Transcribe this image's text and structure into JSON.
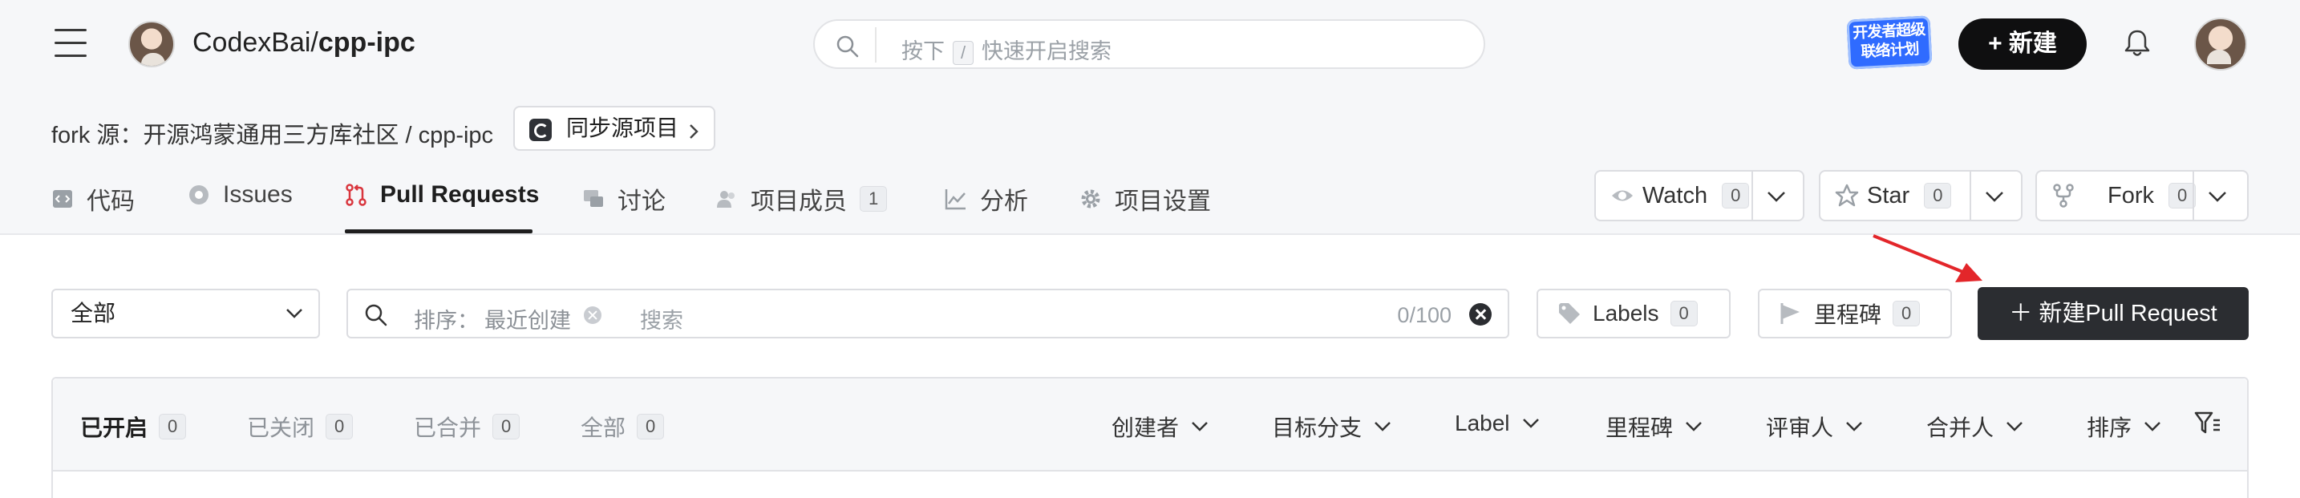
{
  "header": {
    "owner": "CodexBai/",
    "repo": "cpp-ipc",
    "search": {
      "prefix": "按下",
      "key": "/",
      "suffix": "快速开启搜索"
    },
    "dev_badge": "开发者超级联络计划",
    "new_label": "新建"
  },
  "fork": {
    "source_text": "fork 源：开源鸿蒙通用三方库社区 / cpp-ipc",
    "sync_label": "同步源项目"
  },
  "tabs": [
    {
      "label": "代码"
    },
    {
      "label": "Issues"
    },
    {
      "label": "Pull Requests"
    },
    {
      "label": "讨论"
    },
    {
      "label": "项目成员",
      "count": "1"
    },
    {
      "label": "分析"
    },
    {
      "label": "项目设置"
    }
  ],
  "repo_actions": {
    "watch": {
      "label": "Watch",
      "count": "0"
    },
    "star": {
      "label": "Star",
      "count": "0"
    },
    "fork": {
      "label": "Fork",
      "count": "0"
    }
  },
  "filters": {
    "scope": "全部",
    "sort_label": "排序：",
    "sort_value": "最近创建",
    "search_placeholder": "搜索",
    "counter": "0/100",
    "labels": {
      "label": "Labels",
      "count": "0"
    },
    "milestone": {
      "label": "里程碑",
      "count": "0"
    },
    "new_pr": "新建Pull Request"
  },
  "list": {
    "states": [
      {
        "label": "已开启",
        "count": "0"
      },
      {
        "label": "已关闭",
        "count": "0"
      },
      {
        "label": "已合并",
        "count": "0"
      },
      {
        "label": "全部",
        "count": "0"
      }
    ],
    "dropdowns": [
      "创建者",
      "目标分支",
      "Label",
      "里程碑",
      "评审人",
      "合并人",
      "排序"
    ]
  },
  "colors": {
    "accent_dark": "#2b2d31",
    "header_bg": "#f6f7f9",
    "badge_blue": "#2f6bff",
    "arrow_red": "#e3262a",
    "pr_icon_red": "#d9363e"
  }
}
